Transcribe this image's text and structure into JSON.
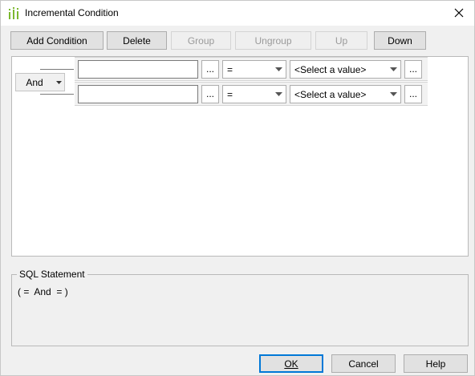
{
  "window": {
    "title": "Incremental Condition",
    "icon": "condition-icon",
    "close_icon": "close-icon"
  },
  "toolbar": {
    "add_condition": "Add Condition",
    "delete": "Delete",
    "group": "Group",
    "ungroup": "Ungroup",
    "up": "Up",
    "down": "Down"
  },
  "condition_group": {
    "operator": "And",
    "rows": [
      {
        "field_value": "",
        "ellipsis": "...",
        "operator": "=",
        "value": "<Select a value>",
        "value_ellipsis": "..."
      },
      {
        "field_value": "",
        "ellipsis": "...",
        "operator": "=",
        "value": "<Select a value>",
        "value_ellipsis": "..."
      }
    ]
  },
  "sql": {
    "label": "SQL Statement",
    "statement": "( =  And  = )"
  },
  "footer": {
    "ok": "OK",
    "cancel": "Cancel",
    "help": "Help"
  },
  "colors": {
    "accent": "#0078d7",
    "icon_green": "#7cb82f"
  }
}
